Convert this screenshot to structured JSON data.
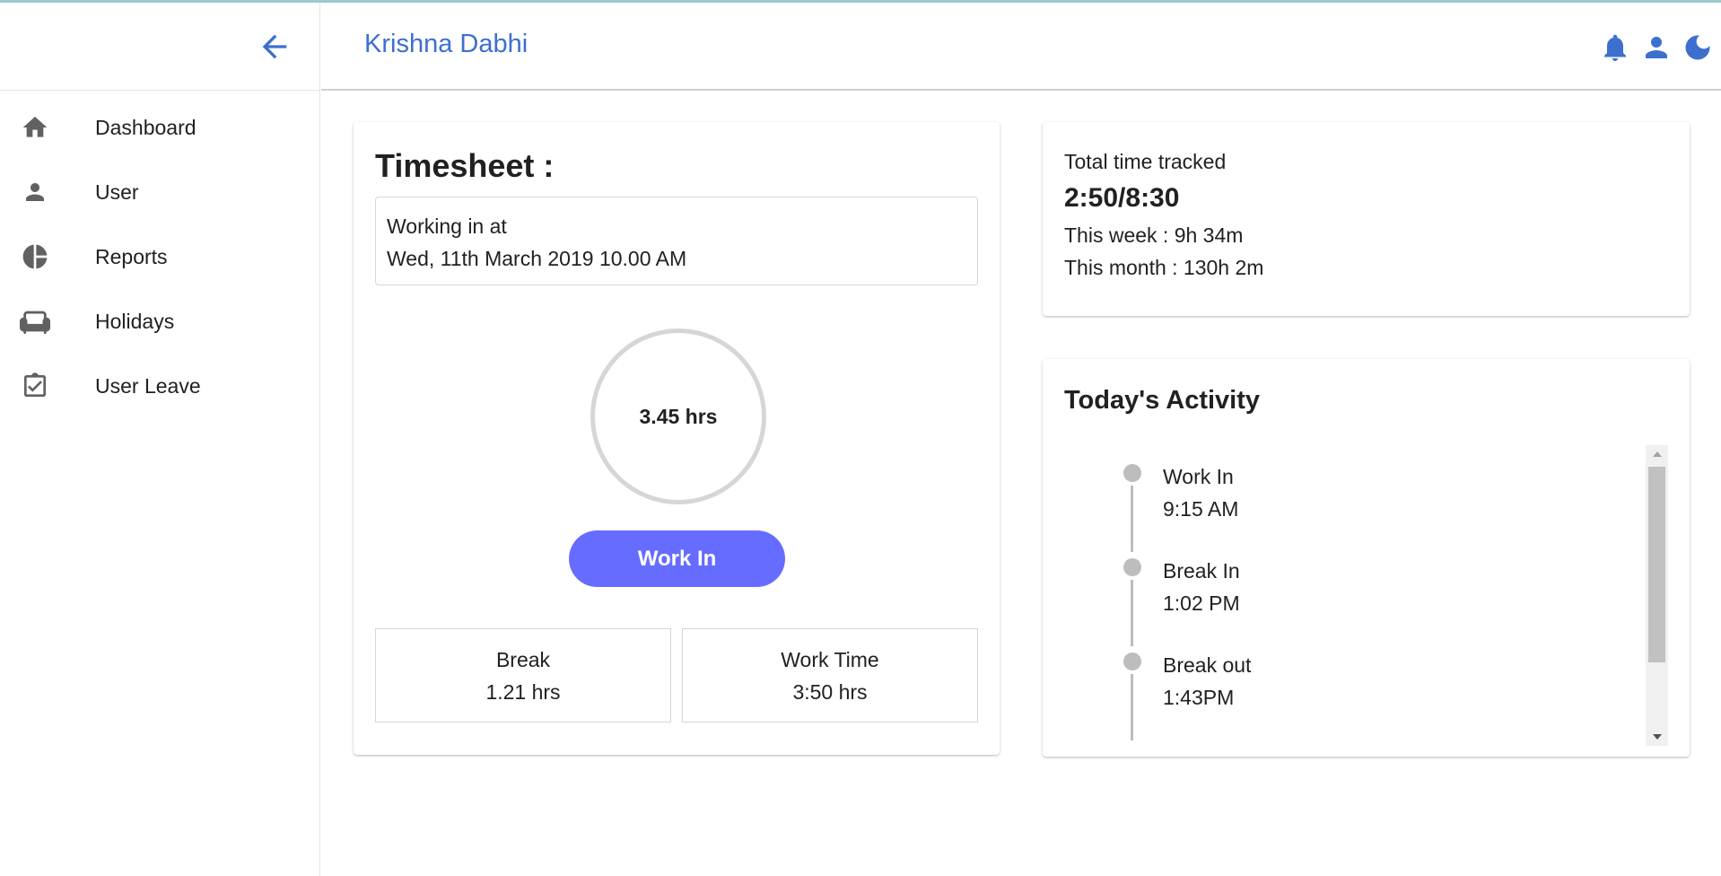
{
  "header": {
    "user_name": "Krishna Dabhi",
    "icons": [
      "bell-icon",
      "person-icon",
      "moon-icon"
    ],
    "accent_color": "#3d6fcf"
  },
  "sidebar": {
    "back_icon": "arrow-left-icon",
    "items": [
      {
        "label": "Dashboard",
        "icon": "home-icon"
      },
      {
        "label": "User",
        "icon": "person-icon"
      },
      {
        "label": "Reports",
        "icon": "pie-chart-icon"
      },
      {
        "label": "Holidays",
        "icon": "sofa-icon"
      },
      {
        "label": "User Leave",
        "icon": "calendar-check-icon"
      }
    ]
  },
  "timesheet": {
    "title": "Timesheet :",
    "working_label": "Working in at",
    "working_datetime": "Wed, 11th March 2019 10.00 AM",
    "hours": "3.45 hrs",
    "button_label": "Work In",
    "button_color": "#666cff",
    "break": {
      "label": "Break",
      "value": "1.21 hrs"
    },
    "work_time": {
      "label": "Work Time",
      "value": "3:50 hrs"
    }
  },
  "total": {
    "label": "Total time tracked",
    "value": "2:50/8:30",
    "week": "This week : 9h 34m",
    "month": "This month : 130h 2m"
  },
  "activity": {
    "title": "Today's Activity",
    "items": [
      {
        "label": "Work In",
        "time": "9:15 AM"
      },
      {
        "label": "Break In",
        "time": "1:02 PM"
      },
      {
        "label": "Break out",
        "time": "1:43PM"
      }
    ]
  }
}
